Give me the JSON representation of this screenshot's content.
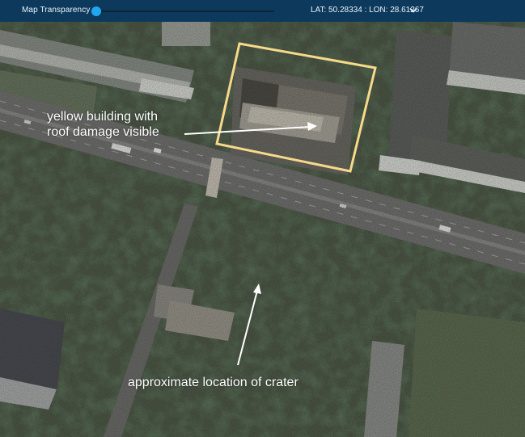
{
  "toolbar": {
    "transparency_label": "Map Transparency",
    "transparency_value": 0,
    "coordinates": "LAT: 50.28334 : LON: 28.61267",
    "chevron_icon": "chevron-down-icon"
  },
  "annotations": {
    "building_label_line1": "yellow building with",
    "building_label_line2": "roof damage visible",
    "crater_label": "approximate location of crater"
  },
  "colors": {
    "toolbar_bg": "#0d3a5c",
    "slider_knob": "#21a7f2",
    "highlight_box": "#f6d98a",
    "annotation_text": "#ffffff"
  }
}
